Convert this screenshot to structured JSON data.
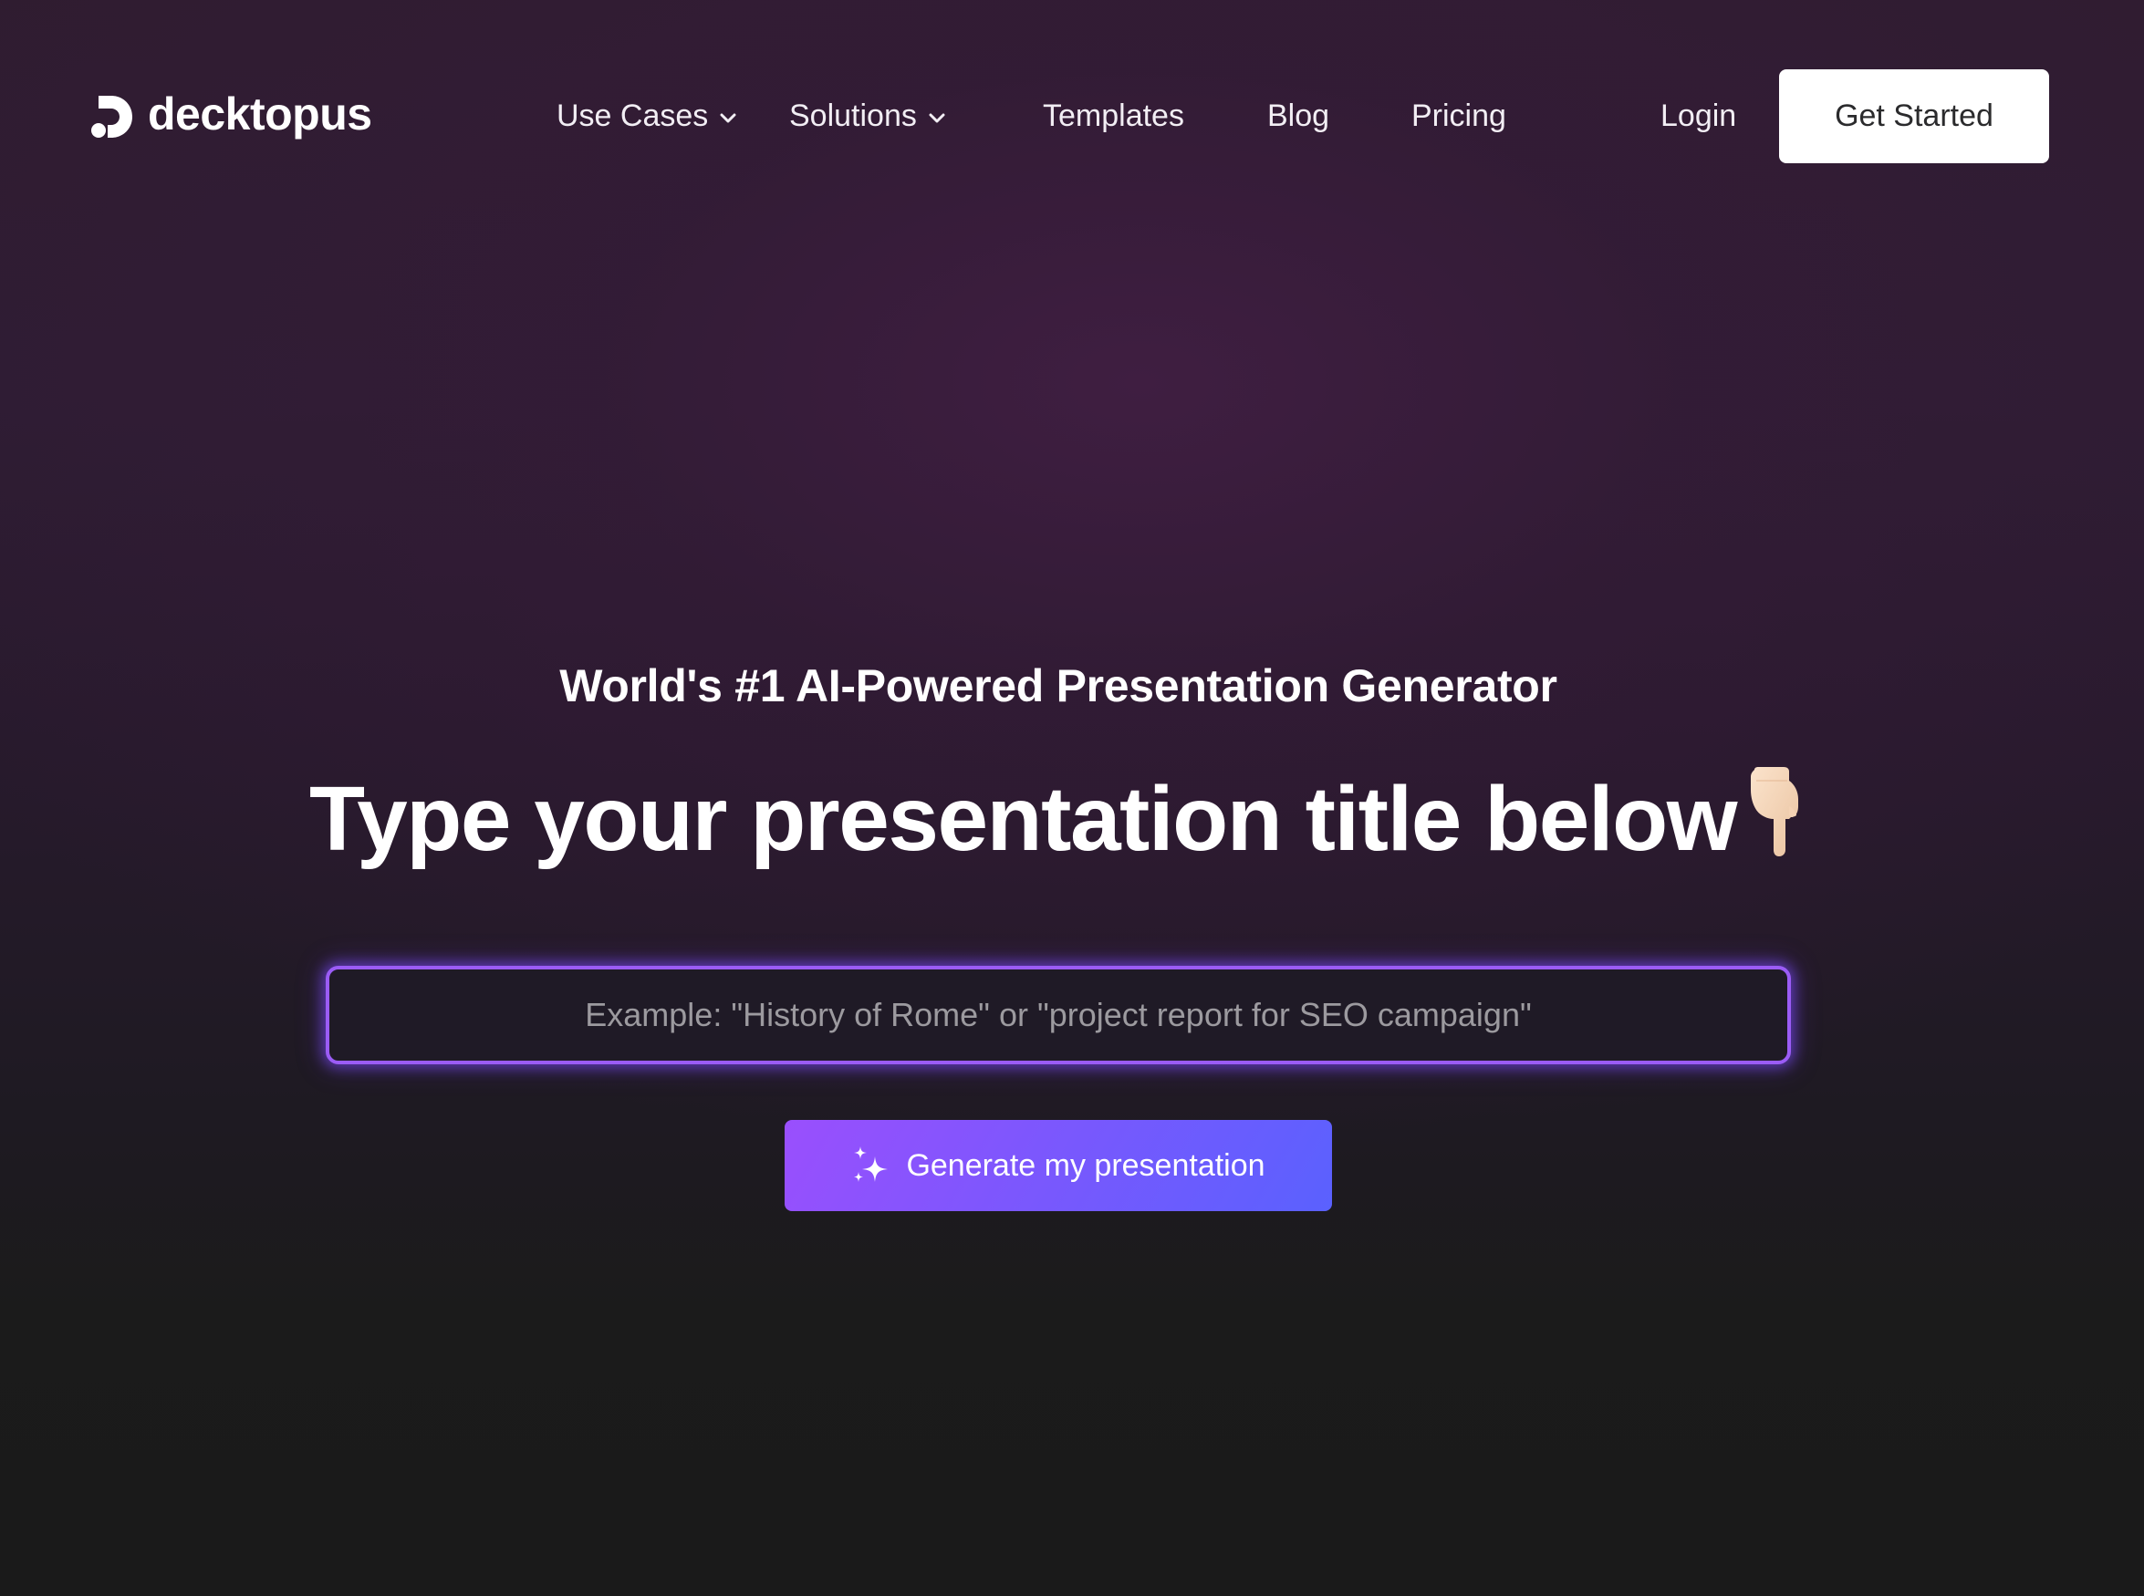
{
  "brand": {
    "name": "decktopus",
    "logo_icon": "decktopus-logo-icon"
  },
  "nav": {
    "items": [
      {
        "label": "Use Cases",
        "has_dropdown": true,
        "icon": "chevron-down-icon"
      },
      {
        "label": "Solutions",
        "has_dropdown": true,
        "icon": "chevron-down-icon"
      },
      {
        "label": "Templates",
        "has_dropdown": false
      },
      {
        "label": "Blog",
        "has_dropdown": false
      },
      {
        "label": "Pricing",
        "has_dropdown": false
      }
    ],
    "login_label": "Login",
    "get_started_label": "Get Started"
  },
  "hero": {
    "subtitle": "World's #1 AI-Powered Presentation Generator",
    "title": "Type your presentation title below",
    "title_emoji": "backhand-index-pointing-down-light-skin-tone",
    "input": {
      "value": "",
      "placeholder": "Example: \"History of Rome\" or \"project report for SEO campaign\""
    },
    "generate_label": "Generate my presentation",
    "generate_icon": "sparkles-icon"
  },
  "colors": {
    "accent_purple": "#9b5cf6",
    "button_gradient_start": "#9a4ffd",
    "button_gradient_end": "#5a61fe",
    "background_top": "#2f1c30",
    "background_bottom": "#1a1a1a",
    "placeholder": "#9c9a9f"
  }
}
